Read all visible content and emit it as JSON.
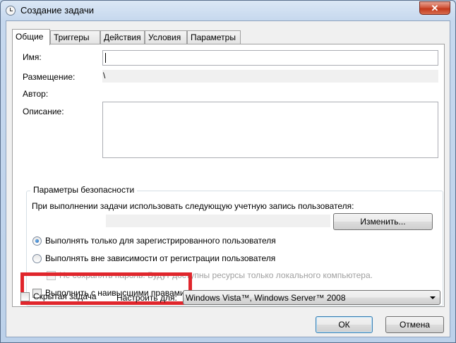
{
  "window": {
    "title": "Создание задачи",
    "close_glyph": "✕"
  },
  "tabs": [
    {
      "label": "Общие",
      "active": true
    },
    {
      "label": "Триггеры"
    },
    {
      "label": "Действия"
    },
    {
      "label": "Условия"
    },
    {
      "label": "Параметры"
    }
  ],
  "general": {
    "name_label": "Имя:",
    "name_value": "",
    "location_label": "Размещение:",
    "location_value": "\\",
    "author_label": "Автор:",
    "author_value": "",
    "description_label": "Описание:",
    "description_value": ""
  },
  "security": {
    "group_title": "Параметры безопасности",
    "account_prompt": "При выполнении задачи использовать следующую учетную запись пользователя:",
    "account_value": "",
    "change_button": "Изменить...",
    "radio_logged_on": {
      "label": "Выполнять только для зарегистрированного пользователя",
      "checked": true
    },
    "radio_any": {
      "label": "Выполнять вне зависимости от регистрации пользователя",
      "checked": false
    },
    "no_store_password": {
      "label": "Не сохранять пароль. Будут доступны ресурсы только локального компьютера.",
      "checked": false,
      "enabled": false
    },
    "highest_privileges": {
      "label": "Выполнить с наивысшими правами",
      "checked": false
    }
  },
  "footer": {
    "hidden_task": {
      "label": "Скрытая задача",
      "checked": false
    },
    "configure_label": "Настроить для:",
    "configure_value": "Windows Vista™, Windows Server™ 2008",
    "ok_button": "ОК",
    "cancel_button": "Отмена"
  },
  "colors": {
    "highlight": "#e0262c",
    "close_button": "#c3391c"
  }
}
